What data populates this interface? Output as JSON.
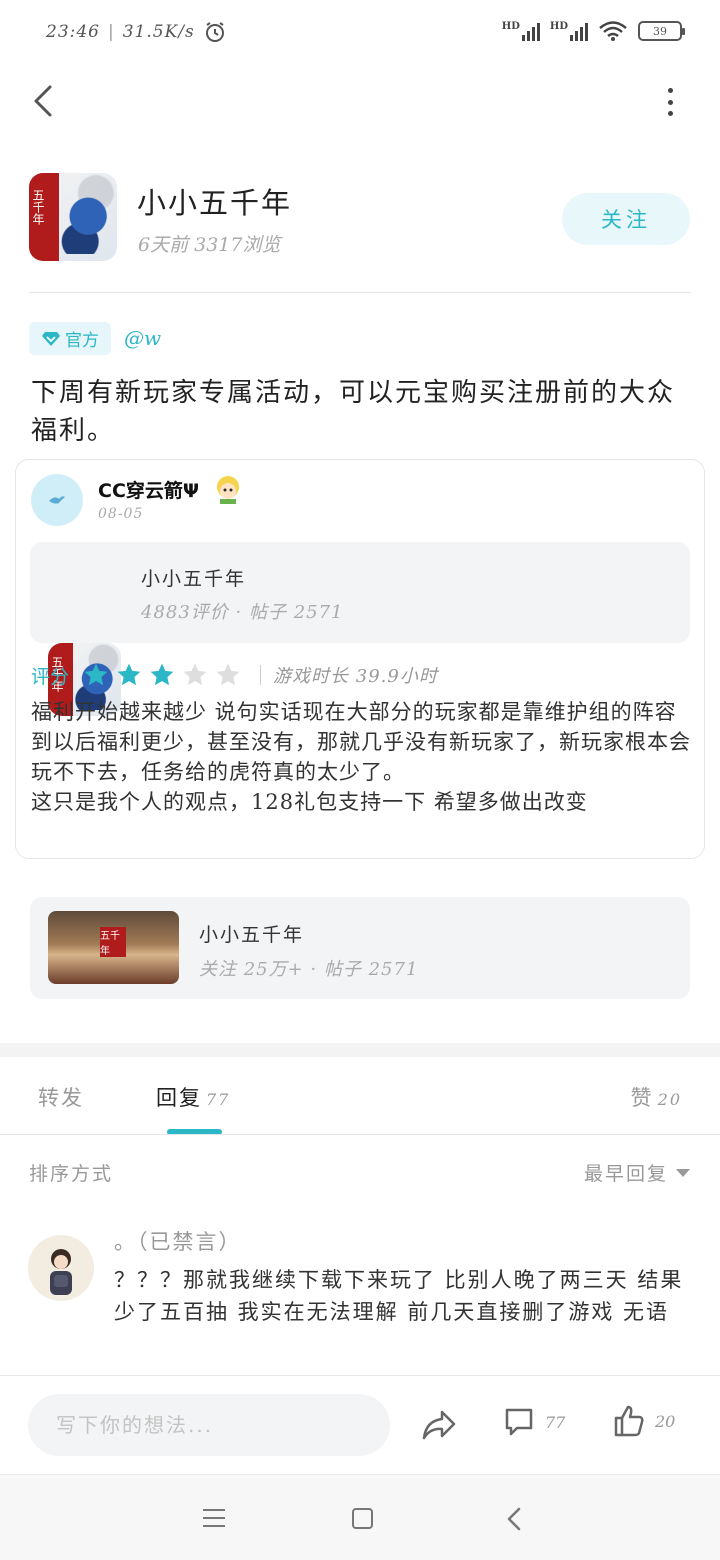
{
  "status_bar": {
    "time": "23:46",
    "net_speed": "31.5K/s",
    "battery": "39",
    "signal_label": "HD"
  },
  "header": {
    "back_icon": "chevron-left-icon",
    "more_icon": "more-vertical-icon"
  },
  "author": {
    "name": "小小五千年",
    "meta": "6天前 3317浏览",
    "follow_label": "关注",
    "icon_text": "五千年"
  },
  "post": {
    "badge_label": "官方",
    "mention": "@w",
    "text": "下周有新玩家专属活动，可以元宝购买注册前的大众福利。"
  },
  "review": {
    "reviewer_name": "CC穿云箭Ψ",
    "date": "08-05",
    "game": {
      "title": "小小五千年",
      "stats": "4883评价 · 帖子 2571"
    },
    "rating_label": "评分",
    "rating": 3,
    "rating_max": 5,
    "playtime": "游戏时长 39.9小时",
    "text": "福利开始越来越少 说句实话现在大部分的玩家都是靠维护组的阵容 到以后福利更少，甚至没有，那就几乎没有新玩家了，新玩家根本会玩不下去，任务给的虎符真的太少了。\n这只是我个人的观点，128礼包支持一下 希望多做出改变"
  },
  "community": {
    "title": "小小五千年",
    "stats": "关注 25万+ · 帖子 2571"
  },
  "tabs": {
    "forward": "转发",
    "reply": "回复",
    "reply_count": "77",
    "like": "赞",
    "like_count": "20"
  },
  "sort": {
    "label": "排序方式",
    "value": "最早回复"
  },
  "comment": {
    "name": "。（已禁言）",
    "text": "？？？那就我继续下载下来玩了  比别人晚了两三天 结果少了五百抽  我实在无法理解  前几天直接删了游戏 无语"
  },
  "bottom_bar": {
    "placeholder": "写下你的想法...",
    "reply_count": "77",
    "like_count": "20"
  },
  "colors": {
    "accent": "#2cb7c6",
    "star_on": "#2cb7c6",
    "star_off": "#dedede"
  }
}
